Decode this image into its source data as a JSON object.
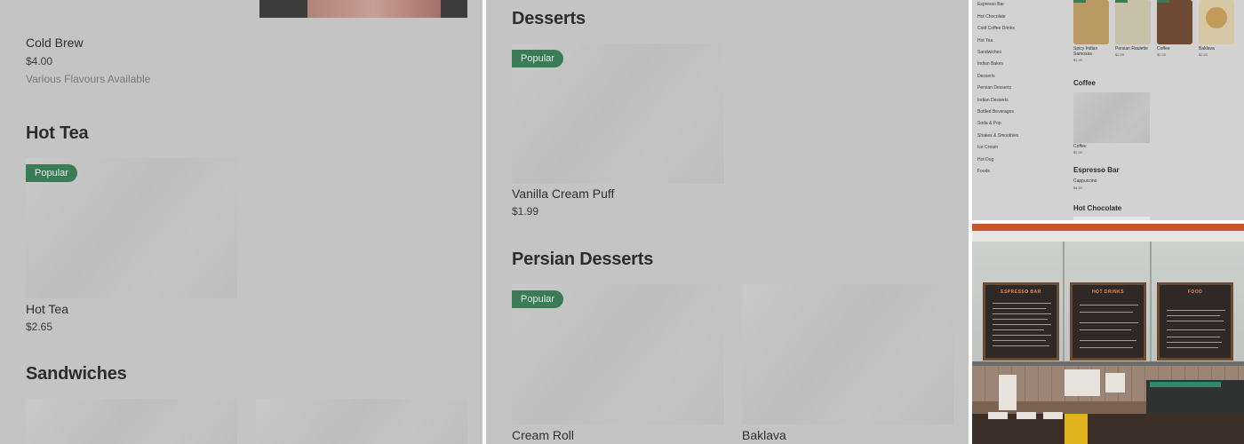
{
  "left_panel": {
    "cold_brew": {
      "name": "Cold Brew",
      "price": "$4.00",
      "desc": "Various Flavours Available"
    },
    "hot_tea_heading": "Hot Tea",
    "hot_tea_item": {
      "badge": "Popular",
      "name": "Hot Tea",
      "price": "$2.65"
    },
    "sandwiches_heading": "Sandwiches"
  },
  "middle_panel": {
    "desserts_heading": "Desserts",
    "vanilla": {
      "badge": "Popular",
      "name": "Vanilla Cream Puff",
      "price": "$1.99"
    },
    "persian_heading": "Persian Desserts",
    "cream_roll": {
      "badge": "Popular",
      "name": "Cream Roll"
    },
    "baklava": {
      "name": "Baklava"
    }
  },
  "mini_screenshot": {
    "sidebar": [
      "Espresso Bar",
      "Hot Chocolate",
      "Cold Coffee Drinks",
      "Hot Tea",
      "Sandwiches",
      "Indian Bakes",
      "Desserts",
      "Persian Desserts",
      "Indian Desserts",
      "Bottled Beverages",
      "Soda & Pop",
      "Shakes & Smoothies",
      "Ice Cream",
      "Hot Dog",
      "Foods"
    ],
    "top_items": [
      {
        "name": "Spicy Indian Samosas",
        "price": "$1.95"
      },
      {
        "name": "Persian Roulette",
        "price": "$2.99"
      },
      {
        "name": "Coffee",
        "price": "$2.00"
      },
      {
        "name": "Baklava",
        "price": "$2.50"
      }
    ],
    "coffee_heading": "Coffee",
    "coffee_item": {
      "name": "Coffee",
      "price": "$2.00"
    },
    "espresso_heading": "Espresso Bar",
    "espresso_item": {
      "name": "Cappuccino",
      "price": "$4.50"
    },
    "hot_chocolate_heading": "Hot Chocolate"
  },
  "photo": {
    "boards": [
      "ESPRESSO BAR",
      "HOT DRINKS",
      "FOOD"
    ]
  },
  "colors": {
    "badge": "#3a7c56",
    "overlay": "#c4c4c4",
    "board_accent": "#e88a56"
  }
}
